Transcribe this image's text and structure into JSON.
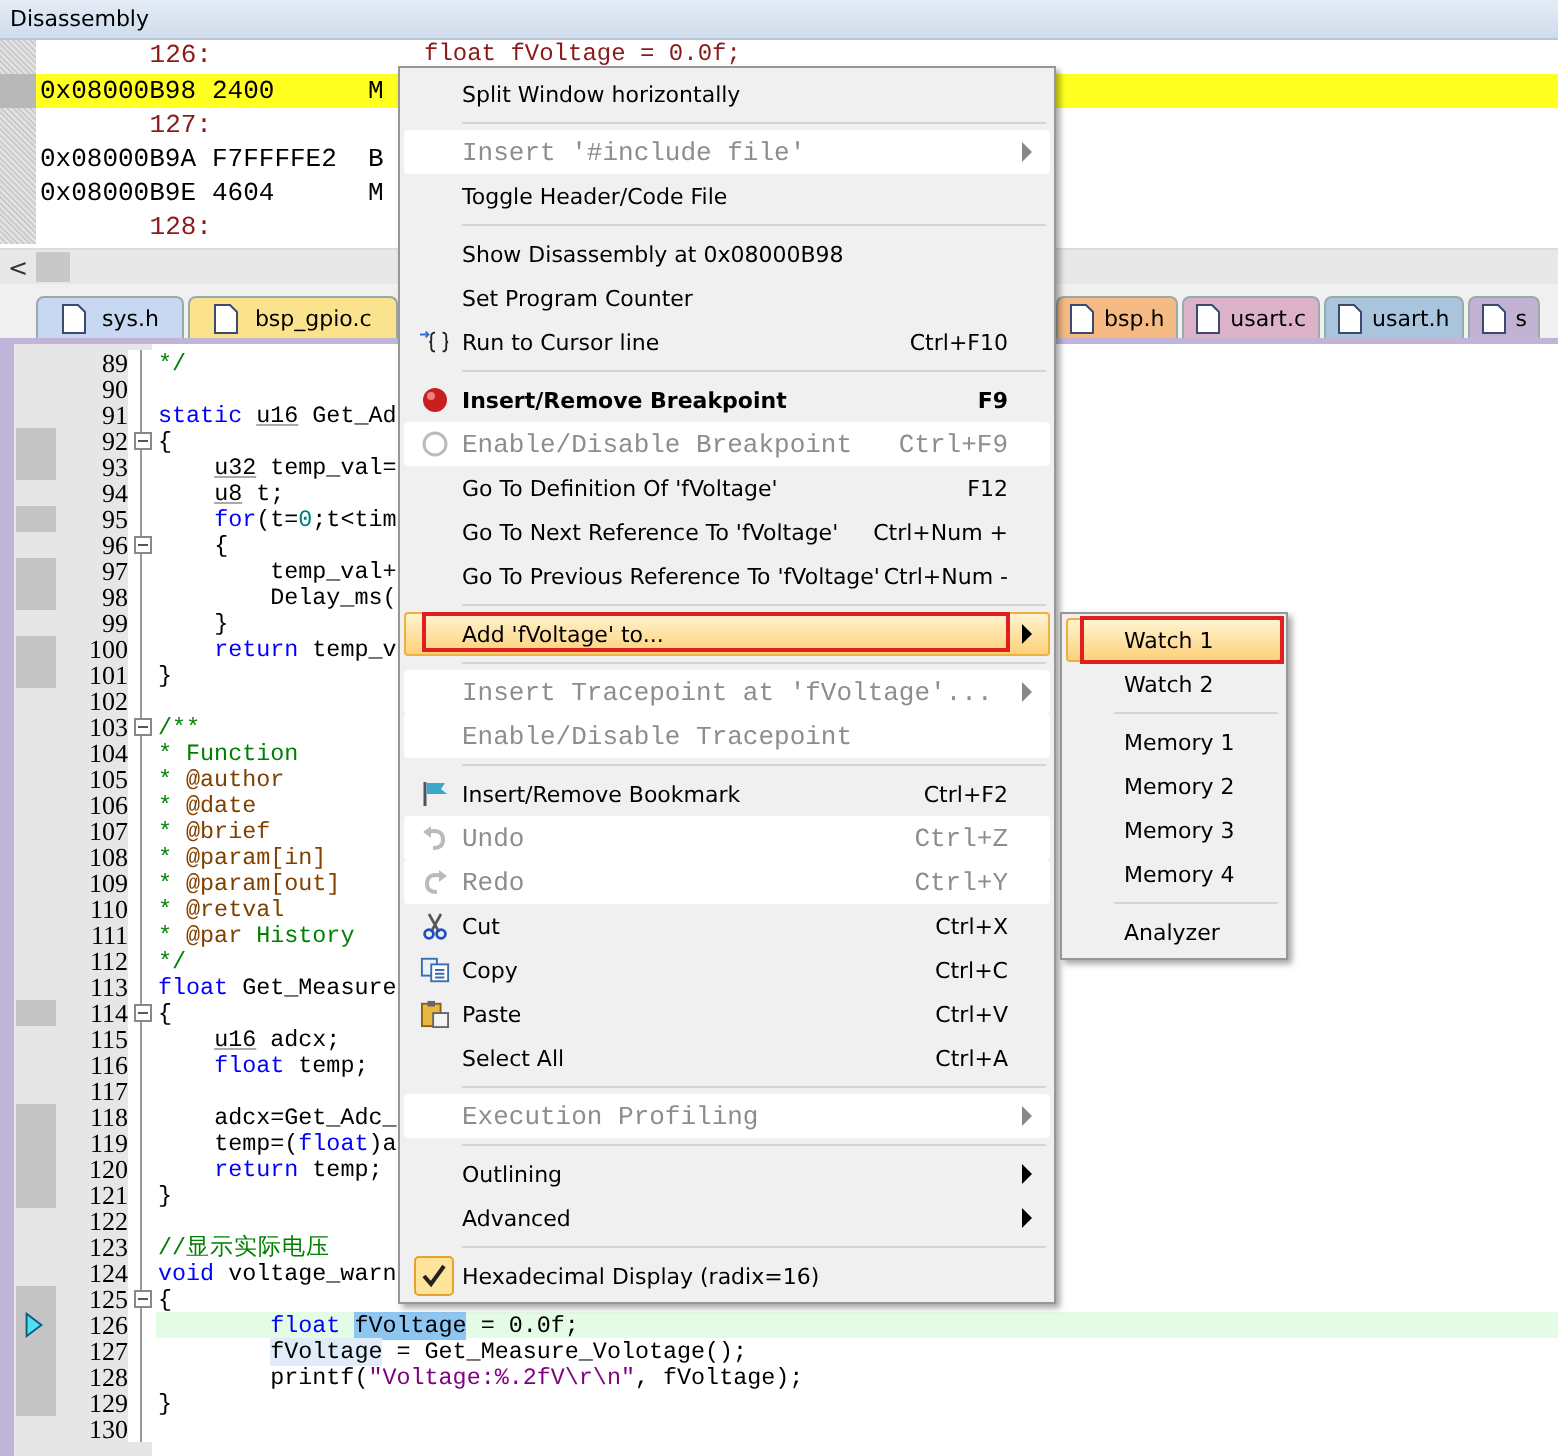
{
  "disassembly": {
    "title": "Disassembly",
    "rows": [
      {
        "kind": "source",
        "line": "126:",
        "source": "float fVoltage = 0.0f;",
        "current": false
      },
      {
        "kind": "instr",
        "address": "0x08000B98",
        "opcode": "2400",
        "mnemonic": "M",
        "current": true
      },
      {
        "kind": "source",
        "line": "127:",
        "current": false
      },
      {
        "kind": "instr",
        "address": "0x08000B9A",
        "opcode": "F7FFFFE2",
        "mnemonic": "B",
        "current": false
      },
      {
        "kind": "instr",
        "address": "0x08000B9E",
        "opcode": "4604",
        "mnemonic": "M",
        "current": false
      },
      {
        "kind": "source",
        "line": "128:",
        "current": false
      }
    ],
    "scroll_left": "<"
  },
  "tabs": [
    {
      "label": "sys.h",
      "color": "#c9d8f2",
      "selected": false
    },
    {
      "label": "bsp_gpio.c",
      "color": "#fbe28c",
      "selected": false
    },
    {
      "label": "bsp.h",
      "color": "#f6bb84",
      "selected": false
    },
    {
      "label": "usart.c",
      "color": "#dcb2c9",
      "selected": false
    },
    {
      "label": "usart.h",
      "color": "#a9c5dd",
      "selected": false
    },
    {
      "label": "s",
      "color": "#c2b2d2",
      "selected": false
    }
  ],
  "editor": {
    "lines": [
      {
        "number": "89",
        "executable": false,
        "fold": false,
        "current": false,
        "tokens": [
          {
            "text": "*/",
            "kind": "comment"
          }
        ]
      },
      {
        "number": "90",
        "executable": false,
        "fold": false,
        "current": false
      },
      {
        "number": "91",
        "executable": false,
        "fold": false,
        "current": false,
        "tokens": [
          {
            "text": "static ",
            "kind": "keyword"
          },
          {
            "text": "u16",
            "kind": "type"
          },
          {
            "text": " Get_Ad",
            "kind": "plain"
          }
        ]
      },
      {
        "number": "92",
        "executable": true,
        "fold": true,
        "current": false,
        "tokens": [
          {
            "text": "{",
            "kind": "plain"
          }
        ]
      },
      {
        "number": "93",
        "executable": true,
        "fold": false,
        "current": false,
        "tokens": [
          {
            "text": "    u32",
            "kind": "type"
          },
          {
            "text": " temp_val=",
            "kind": "plain"
          }
        ]
      },
      {
        "number": "94",
        "executable": false,
        "fold": false,
        "current": false,
        "tokens": [
          {
            "text": "    u8",
            "kind": "type"
          },
          {
            "text": " t;",
            "kind": "plain"
          }
        ]
      },
      {
        "number": "95",
        "executable": true,
        "fold": false,
        "current": false,
        "tokens": [
          {
            "text": "    for",
            "kind": "keyword"
          },
          {
            "text": "(t=",
            "kind": "plain"
          },
          {
            "text": "0",
            "kind": "number"
          },
          {
            "text": ";t<tim",
            "kind": "plain"
          }
        ]
      },
      {
        "number": "96",
        "executable": false,
        "fold": true,
        "current": false,
        "tokens": [
          {
            "text": "    {",
            "kind": "plain"
          }
        ]
      },
      {
        "number": "97",
        "executable": true,
        "fold": false,
        "current": false,
        "tokens": [
          {
            "text": "        temp_val+",
            "kind": "plain"
          }
        ]
      },
      {
        "number": "98",
        "executable": true,
        "fold": false,
        "current": false,
        "tokens": [
          {
            "text": "        Delay_ms(",
            "kind": "plain"
          }
        ]
      },
      {
        "number": "99",
        "executable": false,
        "fold": false,
        "current": false,
        "tokens": [
          {
            "text": "    }",
            "kind": "plain"
          }
        ]
      },
      {
        "number": "100",
        "executable": true,
        "fold": false,
        "current": false,
        "tokens": [
          {
            "text": "    return",
            "kind": "keyword"
          },
          {
            "text": " temp_v",
            "kind": "plain"
          }
        ]
      },
      {
        "number": "101",
        "executable": true,
        "fold": false,
        "current": false,
        "tokens": [
          {
            "text": "}",
            "kind": "plain"
          }
        ]
      },
      {
        "number": "102",
        "executable": false,
        "fold": false,
        "current": false
      },
      {
        "number": "103",
        "executable": false,
        "fold": true,
        "current": false,
        "tokens": [
          {
            "text": "/**",
            "kind": "comment"
          }
        ]
      },
      {
        "number": "104",
        "executable": false,
        "fold": false,
        "current": false,
        "tokens": [
          {
            "text": "* Function",
            "kind": "comment"
          }
        ]
      },
      {
        "number": "105",
        "executable": false,
        "fold": false,
        "current": false,
        "tokens": [
          {
            "text": "* ",
            "kind": "comment"
          },
          {
            "text": "@author",
            "kind": "doctag"
          }
        ]
      },
      {
        "number": "106",
        "executable": false,
        "fold": false,
        "current": false,
        "tokens": [
          {
            "text": "* ",
            "kind": "comment"
          },
          {
            "text": "@date",
            "kind": "doctag"
          }
        ]
      },
      {
        "number": "107",
        "executable": false,
        "fold": false,
        "current": false,
        "tokens": [
          {
            "text": "* ",
            "kind": "comment"
          },
          {
            "text": "@brief",
            "kind": "doctag"
          }
        ]
      },
      {
        "number": "108",
        "executable": false,
        "fold": false,
        "current": false,
        "tokens": [
          {
            "text": "* ",
            "kind": "comment"
          },
          {
            "text": "@param[in]",
            "kind": "doctag"
          }
        ]
      },
      {
        "number": "109",
        "executable": false,
        "fold": false,
        "current": false,
        "tokens": [
          {
            "text": "* ",
            "kind": "comment"
          },
          {
            "text": "@param[out]",
            "kind": "doctag"
          }
        ]
      },
      {
        "number": "110",
        "executable": false,
        "fold": false,
        "current": false,
        "tokens": [
          {
            "text": "* ",
            "kind": "comment"
          },
          {
            "text": "@retval",
            "kind": "doctag"
          }
        ]
      },
      {
        "number": "111",
        "executable": false,
        "fold": false,
        "current": false,
        "tokens": [
          {
            "text": "* ",
            "kind": "comment"
          },
          {
            "text": "@par",
            "kind": "doctag"
          },
          {
            "text": " History",
            "kind": "comment"
          }
        ]
      },
      {
        "number": "112",
        "executable": false,
        "fold": false,
        "current": false,
        "tokens": [
          {
            "text": "*/",
            "kind": "comment"
          }
        ]
      },
      {
        "number": "113",
        "executable": false,
        "fold": false,
        "current": false,
        "tokens": [
          {
            "text": "float",
            "kind": "keyword"
          },
          {
            "text": " Get_Measure",
            "kind": "plain"
          }
        ]
      },
      {
        "number": "114",
        "executable": true,
        "fold": true,
        "current": false,
        "tokens": [
          {
            "text": "{",
            "kind": "plain"
          }
        ]
      },
      {
        "number": "115",
        "executable": false,
        "fold": false,
        "current": false,
        "tokens": [
          {
            "text": "    u16",
            "kind": "type"
          },
          {
            "text": " adcx;",
            "kind": "plain"
          }
        ]
      },
      {
        "number": "116",
        "executable": false,
        "fold": false,
        "current": false,
        "tokens": [
          {
            "text": "    float",
            "kind": "keyword"
          },
          {
            "text": " temp;",
            "kind": "plain"
          }
        ]
      },
      {
        "number": "117",
        "executable": false,
        "fold": false,
        "current": false
      },
      {
        "number": "118",
        "executable": true,
        "fold": false,
        "current": false,
        "tokens": [
          {
            "text": "    adcx=Get_Adc_",
            "kind": "plain"
          }
        ]
      },
      {
        "number": "119",
        "executable": true,
        "fold": false,
        "current": false,
        "tokens": [
          {
            "text": "    temp=(",
            "kind": "plain"
          },
          {
            "text": "float",
            "kind": "keyword"
          },
          {
            "text": ")a",
            "kind": "plain"
          }
        ]
      },
      {
        "number": "120",
        "executable": true,
        "fold": false,
        "current": false,
        "tokens": [
          {
            "text": "    return",
            "kind": "keyword"
          },
          {
            "text": " temp;",
            "kind": "plain"
          }
        ]
      },
      {
        "number": "121",
        "executable": true,
        "fold": false,
        "current": false,
        "tokens": [
          {
            "text": "}",
            "kind": "plain"
          }
        ]
      },
      {
        "number": "122",
        "executable": false,
        "fold": false,
        "current": false
      },
      {
        "number": "123",
        "executable": false,
        "fold": false,
        "current": false,
        "tokens": [
          {
            "text": "//显示实际电压",
            "kind": "comment"
          }
        ]
      },
      {
        "number": "124",
        "executable": false,
        "fold": false,
        "current": false,
        "tokens": [
          {
            "text": "void",
            "kind": "keyword"
          },
          {
            "text": " voltage_warn",
            "kind": "plain"
          }
        ]
      },
      {
        "number": "125",
        "executable": true,
        "fold": true,
        "current": false,
        "tokens": [
          {
            "text": "{",
            "kind": "plain"
          }
        ]
      },
      {
        "number": "126",
        "executable": true,
        "fold": false,
        "current": true,
        "tokens": [
          {
            "text": "        float ",
            "kind": "keyword"
          },
          {
            "text": "fVoltage",
            "kind": "selection"
          },
          {
            "text": " = 0.0f;",
            "kind": "plain"
          }
        ]
      },
      {
        "number": "127",
        "executable": true,
        "fold": false,
        "current": false,
        "tokens": [
          {
            "text": "        fVoltage",
            "kind": "reference"
          },
          {
            "text": " = Get_Measure_Volotage();",
            "kind": "plain"
          }
        ]
      },
      {
        "number": "128",
        "executable": true,
        "fold": false,
        "current": false,
        "tokens": [
          {
            "text": "        printf(",
            "kind": "plain"
          },
          {
            "text": "\"Voltage:%.2fV\\r\\n\"",
            "kind": "string"
          },
          {
            "text": ", fVoltage);",
            "kind": "plain"
          }
        ]
      },
      {
        "number": "129",
        "executable": true,
        "fold": false,
        "current": false,
        "tokens": [
          {
            "text": "}",
            "kind": "plain"
          }
        ]
      },
      {
        "number": "130",
        "executable": false,
        "fold": false,
        "current": false
      }
    ]
  },
  "context_menu": {
    "items": [
      {
        "kind": "item",
        "label": "Split Window horizontally",
        "disabled": false,
        "bold": false,
        "submenu": false,
        "selected": false,
        "annotated": false,
        "checked": false
      },
      {
        "kind": "separator"
      },
      {
        "kind": "item",
        "label": "Insert '#include file'",
        "disabled": true,
        "bold": false,
        "submenu": true,
        "selected": false,
        "annotated": false,
        "checked": false
      },
      {
        "kind": "item",
        "label": "Toggle Header/Code File",
        "disabled": false,
        "bold": false,
        "submenu": false,
        "selected": false,
        "annotated": false,
        "checked": false
      },
      {
        "kind": "separator"
      },
      {
        "kind": "item",
        "label": "Show Disassembly at 0x08000B98",
        "disabled": false,
        "bold": false,
        "submenu": false,
        "selected": false,
        "annotated": false,
        "checked": false
      },
      {
        "kind": "item",
        "label": "Set Program Counter",
        "disabled": false,
        "bold": false,
        "submenu": false,
        "selected": false,
        "annotated": false,
        "checked": false
      },
      {
        "kind": "item",
        "label": "Run to Cursor line",
        "shortcut": "Ctrl+F10",
        "disabled": false,
        "bold": false,
        "submenu": false,
        "selected": false,
        "annotated": false,
        "checked": false
      },
      {
        "kind": "separator"
      },
      {
        "kind": "item",
        "label": "Insert/Remove Breakpoint",
        "shortcut": "F9",
        "disabled": false,
        "bold": true,
        "submenu": false,
        "selected": false,
        "annotated": false,
        "checked": false
      },
      {
        "kind": "item",
        "label": "Enable/Disable Breakpoint",
        "shortcut": "Ctrl+F9",
        "disabled": true,
        "bold": false,
        "submenu": false,
        "selected": false,
        "annotated": false,
        "checked": false
      },
      {
        "kind": "item",
        "label": "Go To Definition Of 'fVoltage'",
        "shortcut": "F12",
        "disabled": false,
        "bold": false,
        "submenu": false,
        "selected": false,
        "annotated": false,
        "checked": false
      },
      {
        "kind": "item",
        "label": "Go To Next Reference To 'fVoltage'",
        "shortcut": "Ctrl+Num +",
        "disabled": false,
        "bold": false,
        "submenu": false,
        "selected": false,
        "annotated": false,
        "checked": false
      },
      {
        "kind": "item",
        "label": "Go To Previous Reference To 'fVoltage'",
        "shortcut": "Ctrl+Num -",
        "disabled": false,
        "bold": false,
        "submenu": false,
        "selected": false,
        "annotated": false,
        "checked": false
      },
      {
        "kind": "separator"
      },
      {
        "kind": "item",
        "label": "Add 'fVoltage' to...",
        "disabled": false,
        "bold": false,
        "submenu": true,
        "selected": true,
        "annotated": true,
        "checked": false
      },
      {
        "kind": "separator"
      },
      {
        "kind": "item",
        "label": "Insert Tracepoint at 'fVoltage'...",
        "disabled": true,
        "bold": false,
        "submenu": true,
        "selected": false,
        "annotated": false,
        "checked": false
      },
      {
        "kind": "item",
        "label": "Enable/Disable Tracepoint",
        "disabled": true,
        "bold": false,
        "submenu": false,
        "selected": false,
        "annotated": false,
        "checked": false
      },
      {
        "kind": "separator"
      },
      {
        "kind": "item",
        "label": "Insert/Remove Bookmark",
        "shortcut": "Ctrl+F2",
        "disabled": false,
        "bold": false,
        "submenu": false,
        "selected": false,
        "annotated": false,
        "checked": false
      },
      {
        "kind": "item",
        "label": "Undo",
        "shortcut": "Ctrl+Z",
        "disabled": true,
        "bold": false,
        "submenu": false,
        "selected": false,
        "annotated": false,
        "checked": false
      },
      {
        "kind": "item",
        "label": "Redo",
        "shortcut": "Ctrl+Y",
        "disabled": true,
        "bold": false,
        "submenu": false,
        "selected": false,
        "annotated": false,
        "checked": false
      },
      {
        "kind": "item",
        "label": "Cut",
        "shortcut": "Ctrl+X",
        "disabled": false,
        "bold": false,
        "submenu": false,
        "selected": false,
        "annotated": false,
        "checked": false
      },
      {
        "kind": "item",
        "label": "Copy",
        "shortcut": "Ctrl+C",
        "disabled": false,
        "bold": false,
        "submenu": false,
        "selected": false,
        "annotated": false,
        "checked": false
      },
      {
        "kind": "item",
        "label": "Paste",
        "shortcut": "Ctrl+V",
        "disabled": false,
        "bold": false,
        "submenu": false,
        "selected": false,
        "annotated": false,
        "checked": false
      },
      {
        "kind": "item",
        "label": "Select All",
        "shortcut": "Ctrl+A",
        "disabled": false,
        "bold": false,
        "submenu": false,
        "selected": false,
        "annotated": false,
        "checked": false
      },
      {
        "kind": "separator"
      },
      {
        "kind": "item",
        "label": "Execution Profiling",
        "disabled": true,
        "bold": false,
        "submenu": true,
        "selected": false,
        "annotated": false,
        "checked": false
      },
      {
        "kind": "separator"
      },
      {
        "kind": "item",
        "label": "Outlining",
        "disabled": false,
        "bold": false,
        "submenu": true,
        "selected": false,
        "annotated": false,
        "checked": false
      },
      {
        "kind": "item",
        "label": "Advanced",
        "disabled": false,
        "bold": false,
        "submenu": true,
        "selected": false,
        "annotated": false,
        "checked": false
      },
      {
        "kind": "separator"
      },
      {
        "kind": "item",
        "label": "Hexadecimal Display (radix=16)",
        "disabled": false,
        "bold": false,
        "submenu": false,
        "selected": false,
        "annotated": false,
        "checked": true
      }
    ]
  },
  "submenu": {
    "items": [
      {
        "kind": "item",
        "label": "Watch 1",
        "selected": true,
        "annotated": true
      },
      {
        "kind": "item",
        "label": "Watch 2",
        "selected": false,
        "annotated": false
      },
      {
        "kind": "separator"
      },
      {
        "kind": "item",
        "label": "Memory 1",
        "selected": false,
        "annotated": false
      },
      {
        "kind": "item",
        "label": "Memory 2",
        "selected": false,
        "annotated": false
      },
      {
        "kind": "item",
        "label": "Memory 3",
        "selected": false,
        "annotated": false
      },
      {
        "kind": "item",
        "label": "Memory 4",
        "selected": false,
        "annotated": false
      },
      {
        "kind": "separator"
      },
      {
        "kind": "item",
        "label": "Analyzer",
        "selected": false,
        "annotated": false
      }
    ]
  }
}
